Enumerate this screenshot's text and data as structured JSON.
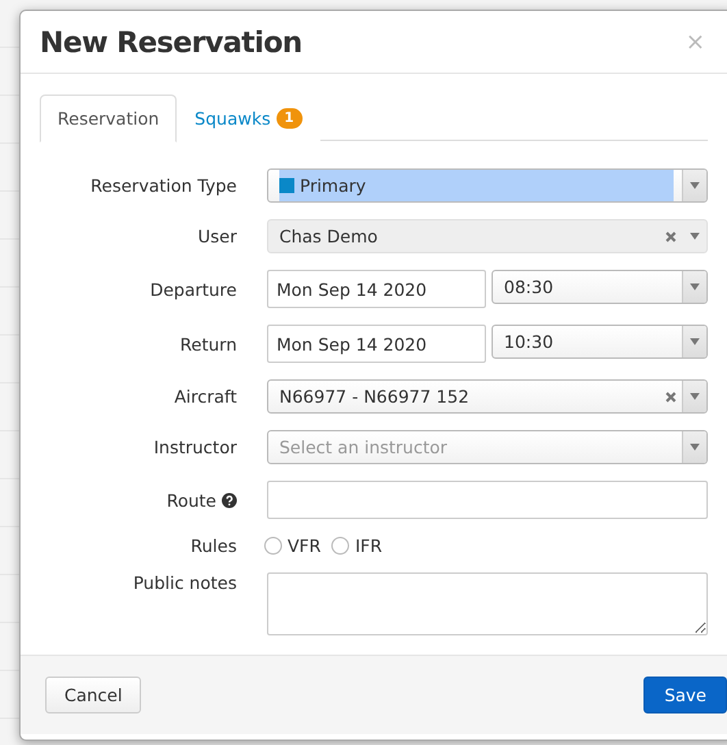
{
  "dialog": {
    "title": "New Reservation",
    "close": "×"
  },
  "tabs": [
    {
      "label": "Reservation",
      "selected": true
    },
    {
      "label": "Squawks",
      "selected": false,
      "badge": "1"
    }
  ],
  "fields": [
    {
      "kind": "type-select",
      "label": "Reservation Type",
      "value": "Primary"
    },
    {
      "kind": "select",
      "label": "User",
      "value": "Chas Demo",
      "clearable": true,
      "disabled": true
    },
    {
      "kind": "datetime",
      "label": "Departure",
      "date": "Mon Sep 14 2020",
      "time": "08:30"
    },
    {
      "kind": "datetime",
      "label": "Return",
      "date": "Mon Sep 14 2020",
      "time": "10:30"
    },
    {
      "kind": "select",
      "label": "Aircraft",
      "value": "N66977 - N66977 152",
      "clearable": true,
      "disabled": false
    },
    {
      "kind": "select",
      "label": "Instructor",
      "placeholder": "Select an instructor",
      "clearable": false,
      "disabled": false
    },
    {
      "kind": "text",
      "label": "Route",
      "help": true
    },
    {
      "kind": "radio",
      "label": "Rules",
      "options": [
        {
          "label": "VFR",
          "selected": false
        },
        {
          "label": "IFR",
          "selected": false
        }
      ]
    },
    {
      "kind": "textarea",
      "label": "Public notes"
    }
  ],
  "footer": {
    "cancel": "Cancel",
    "save": "Save"
  }
}
